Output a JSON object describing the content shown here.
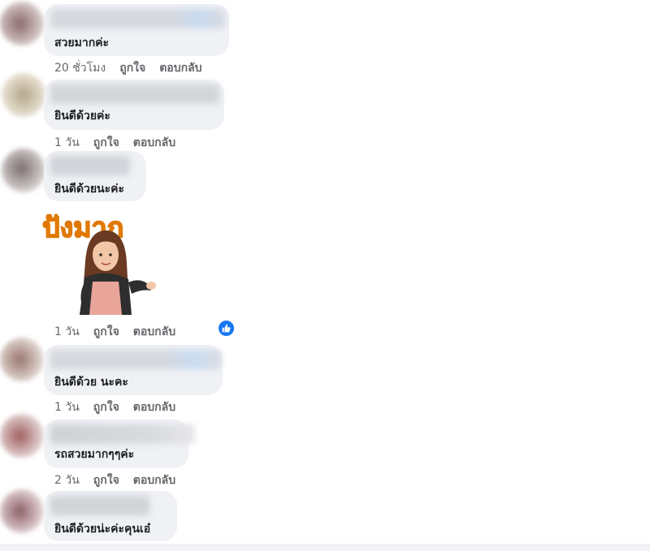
{
  "colors": {
    "bubble": "#eff1f5",
    "meta": "#65676b",
    "like": "#1877f2"
  },
  "comments": [
    {
      "text": "สวยมากค่ะ",
      "time": "20 ชั่วโมง",
      "like_label": "ถูกใจ",
      "reply_label": "ตอบกลับ"
    },
    {
      "text": "ยินดีด้วยค่ะ",
      "time": "1 วัน",
      "like_label": "ถูกใจ",
      "reply_label": "ตอบกลับ"
    },
    {
      "text": "ยินดีด้วยนะค่ะ",
      "time": "1 วัน",
      "like_label": "ถูกใจ",
      "reply_label": "ตอบกลับ",
      "sticker_caption": "ปังมาก",
      "reactions": [
        "like-icon"
      ]
    },
    {
      "text": "ยินดีด้วย นะคะ",
      "time": "1 วัน",
      "like_label": "ถูกใจ",
      "reply_label": "ตอบกลับ"
    },
    {
      "text": "รถสวยมากๆๆค่ะ",
      "time": "2 วัน",
      "like_label": "ถูกใจ",
      "reply_label": "ตอบกลับ"
    },
    {
      "text": "ยินดีด้วยน่ะค่ะคุนเอ๋"
    }
  ]
}
